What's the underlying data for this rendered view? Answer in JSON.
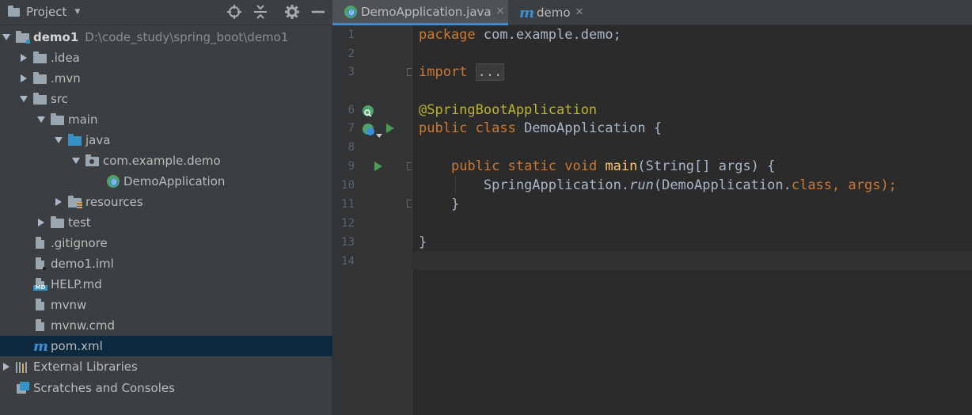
{
  "panel": {
    "title": "Project"
  },
  "tree": [
    {
      "label": "demo1",
      "path": "D:\\code_study\\spring_boot\\demo1"
    },
    {
      "label": ".idea"
    },
    {
      "label": ".mvn"
    },
    {
      "label": "src"
    },
    {
      "label": "main"
    },
    {
      "label": "java"
    },
    {
      "label": "com.example.demo"
    },
    {
      "label": "DemoApplication"
    },
    {
      "label": "resources"
    },
    {
      "label": "test"
    },
    {
      "label": ".gitignore"
    },
    {
      "label": "demo1.iml"
    },
    {
      "label": "HELP.md"
    },
    {
      "label": "mvnw"
    },
    {
      "label": "mvnw.cmd"
    },
    {
      "label": "pom.xml"
    },
    {
      "label": "External Libraries"
    },
    {
      "label": "Scratches and Consoles"
    }
  ],
  "tabs": [
    {
      "label": "DemoApplication.java"
    },
    {
      "label": "demo"
    }
  ],
  "editor": {
    "line_numbers": [
      "1",
      "2",
      "3",
      "6",
      "7",
      "8",
      "9",
      "10",
      "11",
      "12",
      "13",
      "14"
    ],
    "code": {
      "l1_kw": "package",
      "l1_rest": " com.example.demo;",
      "l3_kw": "import",
      "l3_fold": "...",
      "l6": "@SpringBootApplication",
      "l7_kw": "public class",
      "l7_rest": " DemoApplication {",
      "l9_kw": "public static void",
      "l9_fn": "main",
      "l9_rest": "(String[] args) {",
      "l10_a": "SpringApplication.",
      "l10_run": "run",
      "l10_b": "(DemoApplication.",
      "l10_kw": "class",
      "l10_c": ", args);",
      "l11": "}",
      "l13": "}"
    }
  },
  "colors": {
    "keyword": "#cc7832",
    "annotation": "#bbb529",
    "function": "#ffc66d",
    "text": "#a9b7c6",
    "selection": "#0d293e"
  }
}
